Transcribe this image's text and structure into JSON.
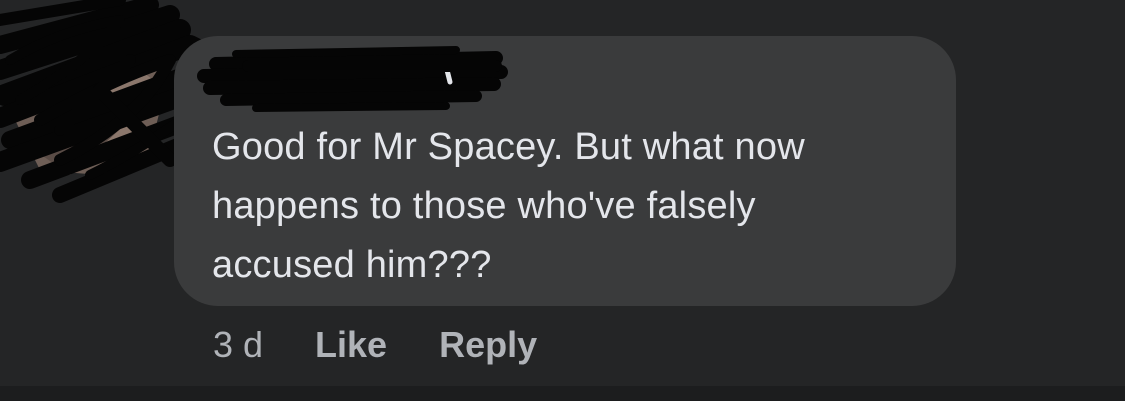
{
  "comment": {
    "author_name": "",
    "text": "Good for Mr Spacey. But what now\nhappens to those who've falsely\naccused him???",
    "timestamp": "3 d",
    "like_label": "Like",
    "reply_label": "Reply"
  },
  "colors": {
    "background": "#242526",
    "bubble": "#3a3b3c",
    "text": "#e4e6eb",
    "secondary_text": "#b0b3b8",
    "scribble": "#050505"
  }
}
